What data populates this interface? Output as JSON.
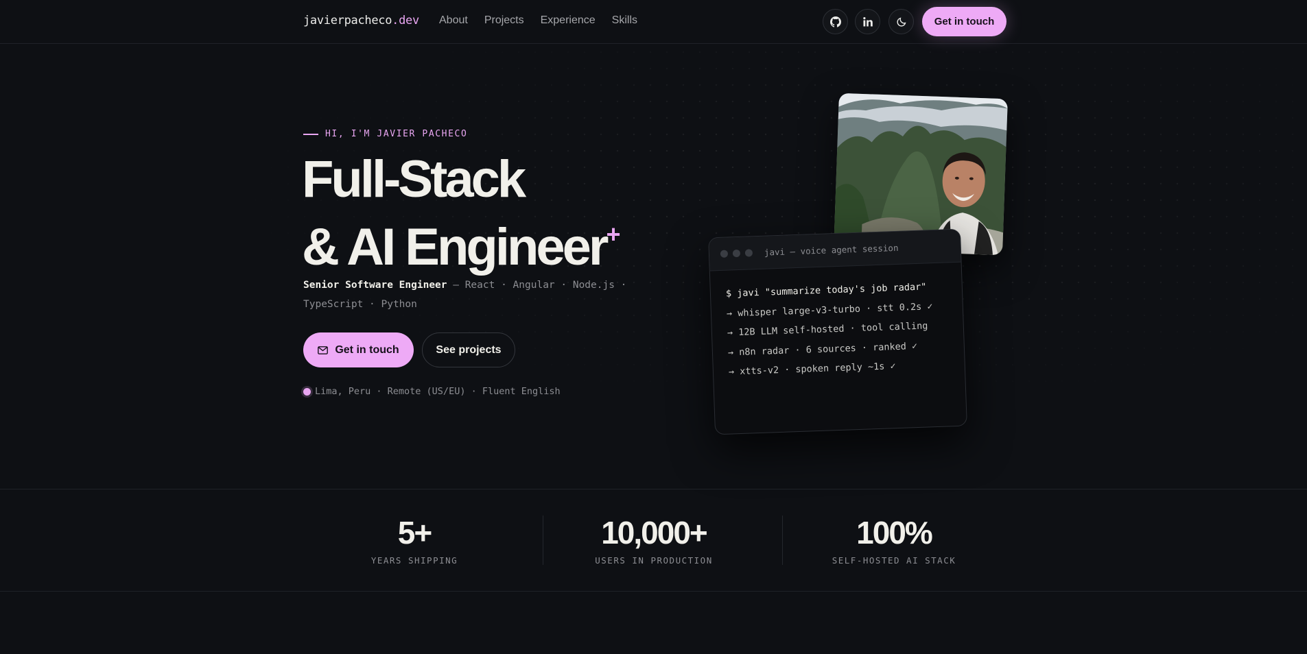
{
  "nav": {
    "brand_name": "javierpacheco",
    "brand_tld": ".dev",
    "links": [
      "About",
      "Projects",
      "Experience",
      "Skills"
    ],
    "cta_label": "Get in touch",
    "icons": [
      "github-icon",
      "linkedin-icon",
      "moon-icon"
    ]
  },
  "hero": {
    "eyebrow": "HI, I'M JAVIER PACHECO",
    "headline_line1": "Full-Stack",
    "headline_line2": "& AI Engineer",
    "headline_mark": "+",
    "role": "Senior Software Engineer",
    "stack": " — React · Angular · Node.js · TypeScript · Python",
    "primary_cta": "Get in touch",
    "secondary_cta": "See projects",
    "location": "Lima, Peru · Remote (US/EU) · Fluent English"
  },
  "terminal": {
    "title": "javi — voice agent session",
    "lines": [
      "$ javi \"summarize today's job radar\"",
      "→ whisper large-v3-turbo · stt 0.2s ✓",
      "→ 12B LLM self-hosted · tool calling",
      "→ n8n radar · 6 sources · ranked ✓",
      "→ xtts-v2 · spoken reply ~1s ✓"
    ]
  },
  "stats": [
    {
      "value": "5+",
      "label": "YEARS SHIPPING"
    },
    {
      "value": "10,000+",
      "label": "USERS IN PRODUCTION"
    },
    {
      "value": "100%",
      "label": "SELF-HOSTED AI STACK"
    }
  ],
  "colors": {
    "background": "#0e1014",
    "accent": "#eeaaf6",
    "text": "#f1f0ea",
    "muted": "#8d8e93"
  }
}
